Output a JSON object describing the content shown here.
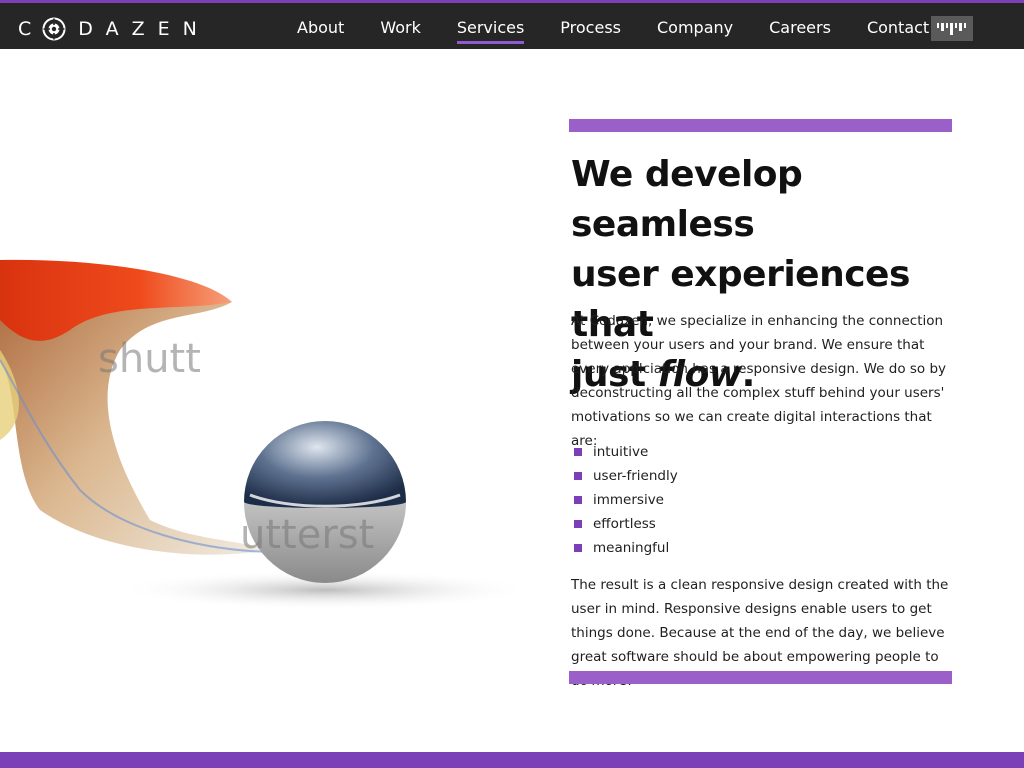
{
  "header": {
    "logo_text": "C DAZEN",
    "nav": [
      "About",
      "Work",
      "Services",
      "Process",
      "Company",
      "Careers",
      "Contact"
    ],
    "active_nav": "Services",
    "badge_icon": "barcode-icon"
  },
  "hero": {
    "headline_line1": "We develop seamless",
    "headline_line2": "user experiences that",
    "headline_line3_plain": "just ",
    "headline_line3_em": "flow",
    "headline_line3_end": ".",
    "intro": "At Codazen, we specialize in enhancing the connection between your users and your brand. We ensure that every applciation has a responsive design. We do so by deconstructing all the complex stuff behind your users' motivations so we can create digital interactions that are:",
    "bullets": [
      "intuitive",
      "user-friendly",
      "immersive",
      "effortless",
      "meaningful"
    ],
    "outro_plain": "The result is a clean responsive design created with the user in mind. Responsive designs enable users to get things done. Because at the end of the day, we believe great software should be about empowering people to do ",
    "outro_em": "more",
    "outro_end": ".",
    "art_watermark_1": "shutt",
    "art_watermark_2": "utterst"
  },
  "colors": {
    "accent": "#7b3fb8",
    "accent_light": "#9b5fc9",
    "topbar": "#262626"
  }
}
